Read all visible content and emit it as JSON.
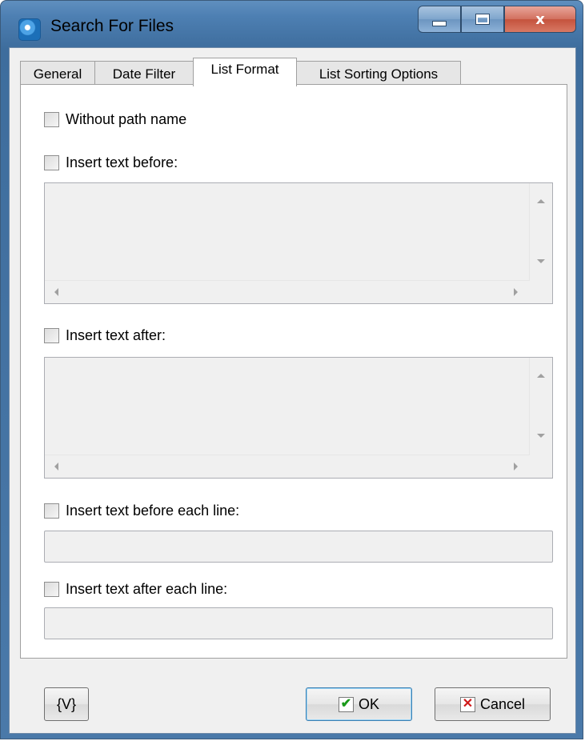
{
  "window": {
    "title": "Search For Files"
  },
  "icons": {
    "app": "app-icon",
    "minimize": "minimize-icon",
    "maximize": "maximize-icon",
    "close": "close-icon",
    "ok": "checkmark-icon",
    "cancel": "x-icon"
  },
  "caption": {
    "close_glyph": "x"
  },
  "tabs": [
    {
      "label": "General"
    },
    {
      "label": "Date Filter"
    },
    {
      "label": "List Format"
    },
    {
      "label": "List Sorting Options"
    }
  ],
  "active_tab": "List Format",
  "options": {
    "without_path": {
      "label": "Without path name",
      "checked": false
    },
    "text_before": {
      "label": "Insert text before:",
      "checked": false,
      "value": ""
    },
    "text_after": {
      "label": "Insert text after:",
      "checked": false,
      "value": ""
    },
    "before_each_line": {
      "label": "Insert text before each line:",
      "checked": false,
      "value": ""
    },
    "after_each_line": {
      "label": "Insert text after each line:",
      "checked": false,
      "value": ""
    }
  },
  "buttons": {
    "variables": "{V}",
    "ok": "OK",
    "cancel": "Cancel"
  },
  "colors": {
    "titlebar": "#4d7fb2",
    "close_button": "#c4523d",
    "ok_check": "#1a9a1a",
    "cancel_x": "#d01818"
  }
}
